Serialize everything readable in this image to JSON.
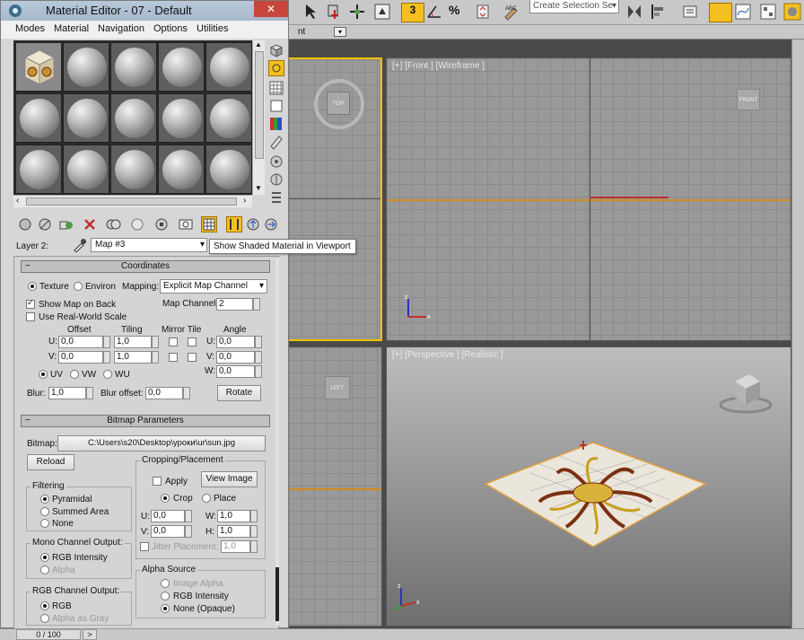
{
  "window": {
    "title": "Material Editor - 07 - Default",
    "close_icon": "close-icon"
  },
  "menu": [
    "Modes",
    "Material",
    "Navigation",
    "Options",
    "Utilities"
  ],
  "layer_label": "Layer 2:",
  "map_name": "Map #3",
  "tooltip": "Show Shaded Material in Viewport",
  "coordinates": {
    "header": "Coordinates",
    "texture": "Texture",
    "environ": "Environ",
    "mapping_label": "Mapping:",
    "mapping_value": "Explicit Map Channel",
    "show_map_on_back": "Show Map on Back",
    "use_real_world": "Use Real-World Scale",
    "map_channel_label": "Map Channel:",
    "map_channel_value": "2",
    "offset": "Offset",
    "tiling": "Tiling",
    "mirror_tile": "Mirror Tile",
    "angle": "Angle",
    "u": "U:",
    "v": "V:",
    "w": "W:",
    "offset_u": "0,0",
    "offset_v": "0,0",
    "tiling_u": "1,0",
    "tiling_v": "1,0",
    "angle_u": "0,0",
    "angle_v": "0,0",
    "angle_w": "0,0",
    "uv": "UV",
    "vw": "VW",
    "wu": "WU",
    "blur_label": "Blur:",
    "blur_value": "1,0",
    "blur_offset_label": "Blur offset:",
    "blur_offset_value": "0,0",
    "rotate": "Rotate"
  },
  "bitmap": {
    "header": "Bitmap Parameters",
    "bitmap_label": "Bitmap:",
    "path": "C:\\Users\\s20\\Desktop\\уроки\\ur\\sun.jpg",
    "reload": "Reload",
    "filtering": "Filtering",
    "pyramidal": "Pyramidal",
    "summed_area": "Summed Area",
    "none": "None",
    "mono_output": "Mono Channel Output:",
    "rgb_intensity": "RGB Intensity",
    "alpha": "Alpha",
    "rgb_output": "RGB Channel Output:",
    "rgb": "RGB",
    "alpha_as_gray": "Alpha as Gray",
    "cropping": "Cropping/Placement",
    "apply": "Apply",
    "view_image": "View Image",
    "crop": "Crop",
    "place": "Place",
    "u": "U:",
    "v": "V:",
    "w": "W:",
    "h": "H:",
    "crop_u": "0,0",
    "crop_v": "0,0",
    "crop_w": "1,0",
    "crop_h": "1,0",
    "jitter": "Jitter Placement:",
    "jitter_value": "1,0",
    "alpha_source": "Alpha Source",
    "image_alpha": "Image Alpha",
    "rgb_intensity2": "RGB Intensity",
    "none_opaque": "None (Opaque)"
  },
  "toolbar": {
    "selection_set": "Create Selection Se",
    "snap_num": "3",
    "percent": "%"
  },
  "subbar": {
    "text": "nt"
  },
  "viewports": {
    "front": "[+] [Front ] [Wireframe ]",
    "perspective": "[+] [Perspective ] [Realistic ]",
    "top_cube": "TOP",
    "front_cube": "FRONT",
    "left_cube": "LEFT"
  },
  "timeline": {
    "frame": "0 / 100",
    "next": ">"
  },
  "colors": {
    "viewport_border_active": "#f0c000",
    "axis_red": "#c03030",
    "axis_blue": "#3030c0",
    "axis_green": "#30a030"
  }
}
